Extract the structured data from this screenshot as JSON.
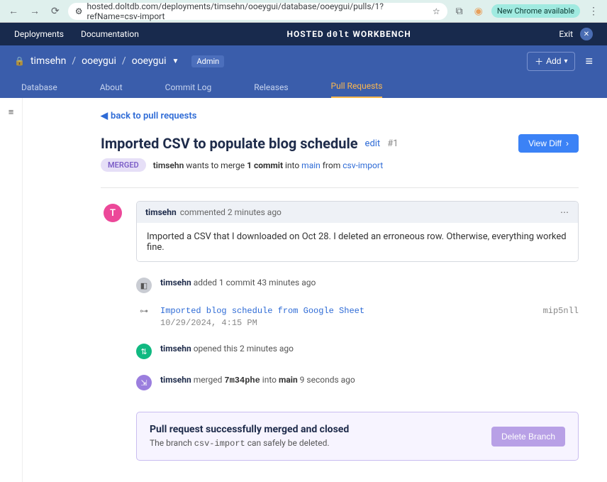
{
  "browser": {
    "url": "hosted.doltdb.com/deployments/timsehn/ooeygui/database/ooeygui/pulls/1?refName=csv-import",
    "chrome_badge": "New Chrome available"
  },
  "topbar": {
    "deployments": "Deployments",
    "documentation": "Documentation",
    "brand_left": "HOSTED",
    "brand_mid": "d0lt",
    "brand_right": "WORKBENCH",
    "exit": "Exit"
  },
  "crumbs": {
    "a": "timsehn",
    "b": "ooeygui",
    "c": "ooeygui",
    "admin": "Admin"
  },
  "actions": {
    "add": "Add"
  },
  "tabs": {
    "database": "Database",
    "about": "About",
    "commitlog": "Commit Log",
    "releases": "Releases",
    "pullrequests": "Pull Requests"
  },
  "back_link": "back to pull requests",
  "pr": {
    "title": "Imported CSV to populate blog schedule",
    "edit": "edit",
    "number": "#1",
    "view_diff": "View Diff",
    "merged_badge": "MERGED",
    "status_user": "timsehn",
    "status_mid1": " wants to merge ",
    "status_commits": "1 commit",
    "status_mid2": " into ",
    "status_base": "main",
    "status_mid3": " from ",
    "status_head": "csv-import"
  },
  "comment": {
    "avatar": "T",
    "user": "timsehn",
    "meta": "commented 2 minutes ago",
    "body": "Imported a CSV that I downloaded on Oct 28. I deleted an erroneous row. Otherwise, everything worked fine."
  },
  "events": {
    "added": {
      "user": "timsehn",
      "text": " added 1 commit 43 minutes ago"
    },
    "commit": {
      "msg": "Imported blog schedule from Google Sheet",
      "date": "10/29/2024, 4:15 PM",
      "hash": "mip5nll"
    },
    "opened": {
      "user": "timsehn",
      "text": " opened this 2 minutes ago"
    },
    "merged": {
      "user": "timsehn",
      "pre": " merged ",
      "hash": "7m34phe",
      "mid": " into ",
      "branch": "main",
      "post": " 9 seconds ago"
    }
  },
  "success": {
    "heading": "Pull request successfully merged and closed",
    "sub_pre": "The branch ",
    "sub_branch": "csv-import",
    "sub_post": " can safely be deleted.",
    "delete": "Delete Branch"
  }
}
